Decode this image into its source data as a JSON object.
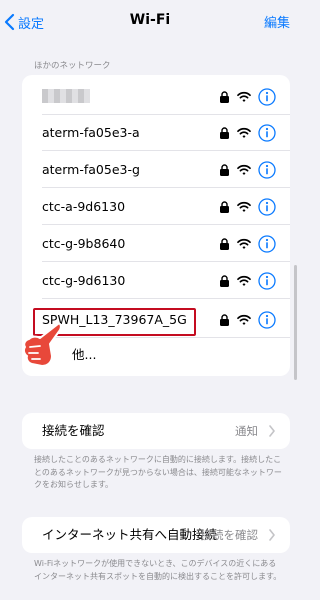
{
  "nav": {
    "back_label": "設定",
    "title": "Wi-Fi",
    "edit_label": "編集"
  },
  "section_header": "ほかのネットワーク",
  "networks": [
    {
      "name": ""
    },
    {
      "name": "aterm-fa05e3-a"
    },
    {
      "name": "aterm-fa05e3-g"
    },
    {
      "name": "ctc-a-9d6130"
    },
    {
      "name": "ctc-g-9b8640"
    },
    {
      "name": "ctc-g-9d6130"
    },
    {
      "name": "SPWH_L13_73967A_5G"
    }
  ],
  "other_label": "他...",
  "ask_to_join": {
    "label": "接続を確認",
    "value": "通知",
    "footnote": "接続したことのあるネットワークに自動的に接続します。接続したことのあるネットワークが見つからない場合は、接続可能なネットワークをお知らせします。"
  },
  "auto_join_hotspot": {
    "label": "インターネット共有へ自動接続",
    "value": "接続を確認",
    "footnote": "Wi-Fiネットワークが使用できないとき、このデバイスの近くにあるインターネット共有スポットを自動的に検出することを許可します。"
  },
  "colors": {
    "accent": "#0a7aff",
    "highlight": "#c40c20",
    "hand": "#e8483a"
  },
  "icons": {
    "lock": "lock-icon",
    "wifi": "wifi-icon",
    "info": "info-icon",
    "chevron": "chevron-right-icon"
  }
}
